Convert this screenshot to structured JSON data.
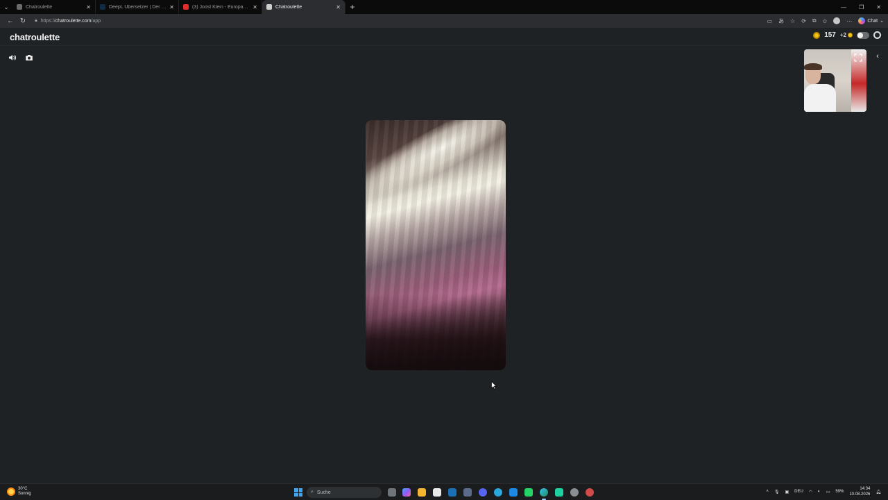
{
  "browser": {
    "tabs": [
      {
        "title": "Chatroulette",
        "favicon_color": "#6c6c6c",
        "active": false
      },
      {
        "title": "DeepL Übersetzer | Der präziseste",
        "favicon_color": "#0f2b46",
        "active": false
      },
      {
        "title": "(3) Joost Klein - Europapa (Hardst",
        "favicon_color": "#e52d27",
        "active": false
      },
      {
        "title": "Chatroulette",
        "favicon_color": "#cfcfcf",
        "active": true
      }
    ],
    "url_prefix": "https://",
    "url_host": "chatroulette.com",
    "url_path": "/app",
    "chat_label": "Chat"
  },
  "header": {
    "logo": "chatroulette",
    "coins": "157",
    "bonus": "+2"
  },
  "stage": {
    "volume_icon": "speaker-icon",
    "camera_icon": "camera-flip-icon",
    "remote_video": "remote-video-feed",
    "self_view": "self-camera-preview"
  },
  "taskbar": {
    "weather_temp": "30°C",
    "weather_desc": "Sonnig",
    "search_placeholder": "Suche",
    "language": "DEU",
    "battery": "59%",
    "time": "14:34",
    "date": "10.08.2026"
  },
  "colors": {
    "background": "#1f2224",
    "coin": "#f2c318",
    "taskbar_accent": "#3ea6f0"
  }
}
